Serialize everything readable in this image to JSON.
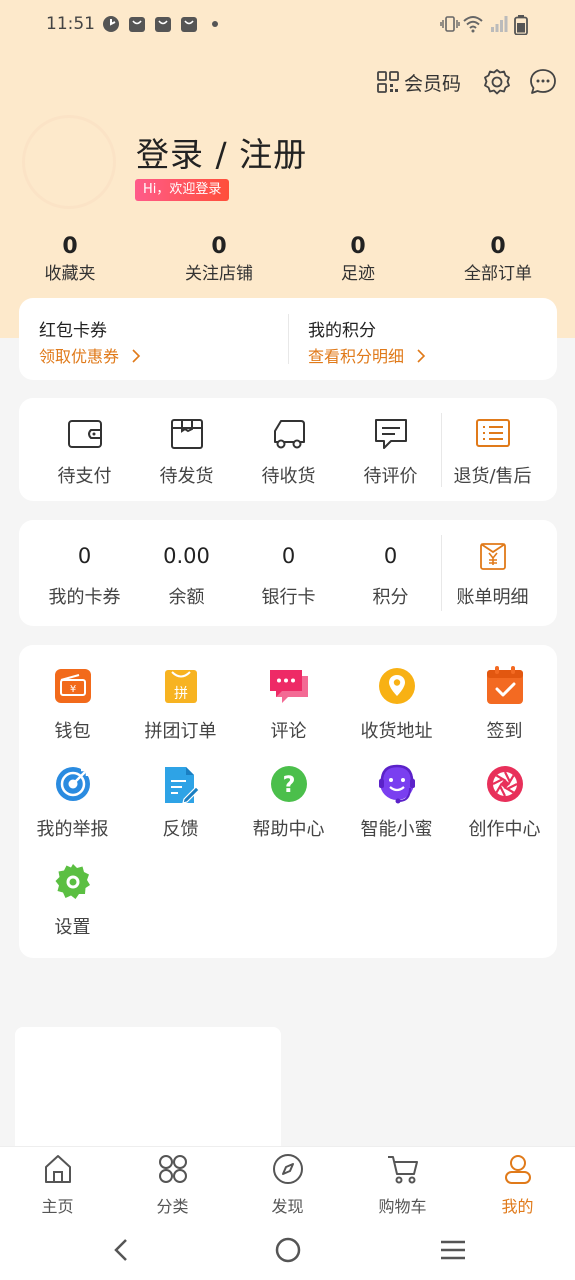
{
  "status_bar": {
    "time": "11:51"
  },
  "header": {
    "member_code_label": "会员码",
    "login_title": "登录 / 注册",
    "welcome_badge": "Hi，欢迎登录"
  },
  "stats": [
    {
      "value": "0",
      "label": "收藏夹"
    },
    {
      "value": "0",
      "label": "关注店铺"
    },
    {
      "value": "0",
      "label": "足迹"
    },
    {
      "value": "0",
      "label": "全部订单"
    }
  ],
  "coupon_card": {
    "left_title": "红包卡券",
    "left_link": "领取优惠券",
    "right_title": "我的积分",
    "right_link": "查看积分明细"
  },
  "orders": [
    {
      "label": "待支付",
      "icon": "wallet-icon"
    },
    {
      "label": "待发货",
      "icon": "box-icon"
    },
    {
      "label": "待收货",
      "icon": "truck-icon"
    },
    {
      "label": "待评价",
      "icon": "comment-icon"
    },
    {
      "label": "退货/售后",
      "icon": "return-list-icon"
    }
  ],
  "assets": [
    {
      "value": "0",
      "label": "我的卡券"
    },
    {
      "value": "0.00",
      "label": "余额"
    },
    {
      "value": "0",
      "label": "银行卡"
    },
    {
      "value": "0",
      "label": "积分"
    },
    {
      "label": "账单明细",
      "icon": "bill-icon"
    }
  ],
  "services": [
    {
      "label": "钱包",
      "icon": "wallet-service-icon",
      "color": "#f26a1b"
    },
    {
      "label": "拼团订单",
      "icon": "group-buy-icon",
      "color": "#f7b321",
      "glyph": "拼"
    },
    {
      "label": "评论",
      "icon": "chat-bubble-icon",
      "color": "#ee2a66"
    },
    {
      "label": "收货地址",
      "icon": "location-pin-icon",
      "color": "#f8b114"
    },
    {
      "label": "签到",
      "icon": "calendar-check-icon",
      "color": "#f36a22"
    },
    {
      "label": "我的举报",
      "icon": "target-icon",
      "color": "#2a8be0"
    },
    {
      "label": "反馈",
      "icon": "document-edit-icon",
      "color": "#2ea3e6"
    },
    {
      "label": "帮助中心",
      "icon": "question-icon",
      "color": "#4bbf4b",
      "glyph": "?"
    },
    {
      "label": "智能小蜜",
      "icon": "smiley-headset-icon",
      "color": "#7a3ff0"
    },
    {
      "label": "创作中心",
      "icon": "aperture-icon",
      "color": "#e8305a"
    },
    {
      "label": "设置",
      "icon": "gear-service-icon",
      "color": "#5bbf42"
    }
  ],
  "tabbar": [
    {
      "label": "主页",
      "icon": "home-icon"
    },
    {
      "label": "分类",
      "icon": "category-icon"
    },
    {
      "label": "发现",
      "icon": "compass-icon"
    },
    {
      "label": "购物车",
      "icon": "cart-icon"
    },
    {
      "label": "我的",
      "icon": "user-icon",
      "active": true
    }
  ],
  "colors": {
    "header_bg": "#fde9cb",
    "accent": "#e07a1a"
  }
}
